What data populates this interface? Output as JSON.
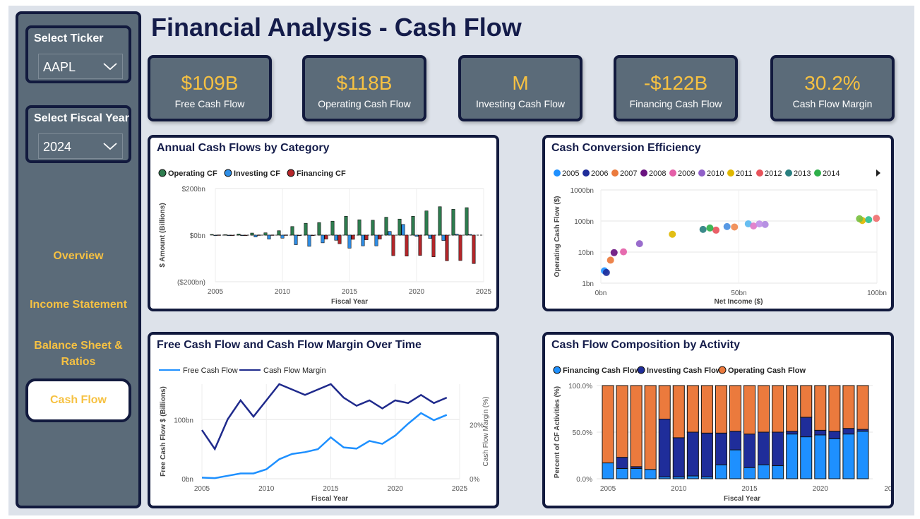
{
  "page": {
    "title": "Financial Analysis - Cash Flow"
  },
  "sidebar": {
    "ticker": {
      "label": "Select Ticker",
      "value": "AAPL"
    },
    "year": {
      "label": "Select Fiscal Year",
      "value": "2024"
    },
    "nav": {
      "overview": "Overview",
      "income": "Income Statement",
      "balance_1": "Balance Sheet &",
      "balance_2": "Ratios",
      "cashflow": "Cash Flow"
    }
  },
  "kpis": [
    {
      "value": "$109B",
      "label": "Free Cash Flow"
    },
    {
      "value": "$118B",
      "label": "Operating Cash Flow"
    },
    {
      "value": "M",
      "label": "Investing Cash Flow"
    },
    {
      "value": "-$122B",
      "label": "Financing Cash Flow"
    },
    {
      "value": "30.2%",
      "label": "Cash Flow Margin"
    }
  ],
  "colors": {
    "accent": "#f6c142",
    "navy": "#121a3e",
    "slate": "#5b6b79",
    "operating": "#2e7d4f",
    "investing": "#2f8ee6",
    "financing": "#b5262a",
    "composition_fin": "#1e90ff",
    "composition_inv": "#1f2d9a",
    "composition_op": "#eb7a3d",
    "fcf_line": "#1e90ff",
    "margin_line": "#1f2a8c"
  },
  "chart_data": [
    {
      "type": "bar",
      "title": "Annual Cash Flows by Category",
      "xlabel": "Fiscal Year",
      "ylabel": "$ Amount (Billions)",
      "ylim": [
        -200,
        200
      ],
      "yticks": [
        "$200bn",
        "$0bn",
        "($200bn)"
      ],
      "xticks": [
        "2005",
        "2010",
        "2015",
        "2020",
        "2025"
      ],
      "grid": true,
      "legend": "top-left",
      "x": [
        2005,
        2006,
        2007,
        2008,
        2009,
        2010,
        2011,
        2012,
        2013,
        2014,
        2015,
        2016,
        2017,
        2018,
        2019,
        2020,
        2021,
        2022,
        2023,
        2024
      ],
      "series": [
        {
          "name": "Operating CF",
          "values": [
            3,
            2,
            5,
            9,
            10,
            19,
            37,
            51,
            54,
            60,
            81,
            66,
            64,
            77,
            69,
            81,
            104,
            122,
            111,
            118
          ]
        },
        {
          "name": "Investing CF",
          "values": [
            -2,
            -1,
            0,
            -8,
            -17,
            -13,
            -41,
            -48,
            -33,
            -22,
            -56,
            -46,
            -46,
            16,
            46,
            -5,
            -14,
            -23,
            4,
            3
          ]
        },
        {
          "name": "Financing CF",
          "values": [
            1,
            -1,
            0,
            1,
            1,
            1,
            0,
            -2,
            -17,
            -37,
            -18,
            -20,
            -17,
            -88,
            -90,
            -87,
            -93,
            -110,
            -109,
            -122
          ]
        }
      ]
    },
    {
      "type": "scatter",
      "title": "Cash Conversion Efficiency",
      "xlabel": "Net Income ($)",
      "ylabel": "Operating Cash Flow ($)",
      "xlim": [
        0,
        100
      ],
      "xticks": [
        "0bn",
        "50bn",
        "100bn"
      ],
      "yscale": "log",
      "ylim": [
        1,
        1000
      ],
      "yticks": [
        "1bn",
        "10bn",
        "100bn",
        "1000bn"
      ],
      "legend": "top",
      "legend_entries": [
        "2005",
        "2006",
        "2007",
        "2008",
        "2009",
        "2010",
        "2011",
        "2012",
        "2013",
        "2014"
      ],
      "points": [
        {
          "year": "2005",
          "x": 1.3,
          "y": 2.5,
          "color": "#1e90ff"
        },
        {
          "year": "2006",
          "x": 2.0,
          "y": 2.2,
          "color": "#1f2d9a"
        },
        {
          "year": "2007",
          "x": 3.5,
          "y": 5.5,
          "color": "#eb7a3d"
        },
        {
          "year": "2008",
          "x": 4.8,
          "y": 9.6,
          "color": "#6a1480"
        },
        {
          "year": "2009",
          "x": 8.2,
          "y": 10.2,
          "color": "#e45fa8"
        },
        {
          "year": "2010",
          "x": 14.0,
          "y": 18.6,
          "color": "#9060c8"
        },
        {
          "year": "2011",
          "x": 25.9,
          "y": 37.5,
          "color": "#e0b800"
        },
        {
          "year": "2012",
          "x": 41.7,
          "y": 50.9,
          "color": "#e8535b"
        },
        {
          "year": "2013",
          "x": 37.0,
          "y": 53.7,
          "color": "#2a8080"
        },
        {
          "year": "2014",
          "x": 39.5,
          "y": 59.7,
          "color": "#2fb04a"
        },
        {
          "year": "2015",
          "x": 53.4,
          "y": 81.3,
          "color": "#5ab8f0"
        },
        {
          "year": "2016",
          "x": 45.7,
          "y": 66.2,
          "color": "#4a90e2"
        },
        {
          "year": "2017",
          "x": 48.4,
          "y": 64.2,
          "color": "#f08a50"
        },
        {
          "year": "2018",
          "x": 59.5,
          "y": 77.4,
          "color": "#b088e0"
        },
        {
          "year": "2019",
          "x": 55.3,
          "y": 69.4,
          "color": "#e078c8"
        },
        {
          "year": "2020",
          "x": 57.4,
          "y": 80.7,
          "color": "#c090e8"
        },
        {
          "year": "2021",
          "x": 94.7,
          "y": 104.0,
          "color": "#e0b800"
        },
        {
          "year": "2022",
          "x": 99.8,
          "y": 122.2,
          "color": "#f07070"
        },
        {
          "year": "2023",
          "x": 97.0,
          "y": 110.5,
          "color": "#2fc090"
        },
        {
          "year": "2024",
          "x": 93.7,
          "y": 118.3,
          "color": "#7ac040"
        }
      ]
    },
    {
      "type": "line",
      "title": "Free Cash Flow and Cash Flow Margin Over Time",
      "xlabel": "Fiscal Year",
      "ylabel": "Free Cash Flow $ (Billions)",
      "y2label": "Cash Flow Margin (%)",
      "ylim": [
        0,
        160
      ],
      "yticks": [
        "0bn",
        "100bn"
      ],
      "y2lim": [
        0,
        35
      ],
      "y2ticks": [
        "0%",
        "20%"
      ],
      "xticks": [
        "2005",
        "2010",
        "2015",
        "2020",
        "2025"
      ],
      "legend": "top-left",
      "x": [
        2005,
        2006,
        2007,
        2008,
        2009,
        2010,
        2011,
        2012,
        2013,
        2014,
        2015,
        2016,
        2017,
        2018,
        2019,
        2020,
        2021,
        2022,
        2023,
        2024
      ],
      "series": [
        {
          "name": "Free Cash Flow",
          "axis": "left",
          "values": [
            2,
            1,
            5,
            9,
            9,
            16,
            33,
            42,
            45,
            50,
            70,
            53,
            51,
            64,
            59,
            73,
            93,
            111,
            99,
            108
          ]
        },
        {
          "name": "Cash Flow Margin",
          "axis": "right",
          "values": [
            18,
            11,
            22,
            29,
            23,
            29,
            35,
            33,
            31,
            33,
            35,
            30,
            27,
            29,
            26,
            29,
            28,
            31,
            28,
            30
          ]
        }
      ]
    },
    {
      "type": "bar",
      "stacked": "percent",
      "title": "Cash Flow Composition by Activity",
      "xlabel": "Fiscal Year",
      "ylabel": "Percent of CF Activities (%)",
      "ylim": [
        0,
        100
      ],
      "yticks": [
        "0.0%",
        "50.0%",
        "100.0%"
      ],
      "xticks": [
        "2005",
        "2010",
        "2015",
        "2020",
        "20..."
      ],
      "legend": "top-left",
      "x": [
        2005,
        2006,
        2007,
        2008,
        2009,
        2010,
        2011,
        2012,
        2013,
        2014,
        2015,
        2016,
        2017,
        2018,
        2019,
        2020,
        2021,
        2022,
        2023
      ],
      "series": [
        {
          "name": "Financing Cash Flow",
          "values": [
            17,
            11,
            11,
            10,
            2,
            2,
            3,
            2,
            15,
            31,
            12,
            15,
            14,
            48,
            45,
            47,
            43,
            48,
            51
          ]
        },
        {
          "name": "Investing Cash Flow",
          "values": [
            0,
            12,
            2,
            0,
            62,
            42,
            47,
            47,
            34,
            20,
            36,
            35,
            36,
            3,
            21,
            5,
            8,
            6,
            2
          ]
        },
        {
          "name": "Operating Cash Flow",
          "values": [
            83,
            77,
            87,
            90,
            36,
            56,
            50,
            51,
            51,
            49,
            52,
            50,
            50,
            49,
            34,
            48,
            49,
            46,
            47
          ]
        }
      ]
    }
  ]
}
